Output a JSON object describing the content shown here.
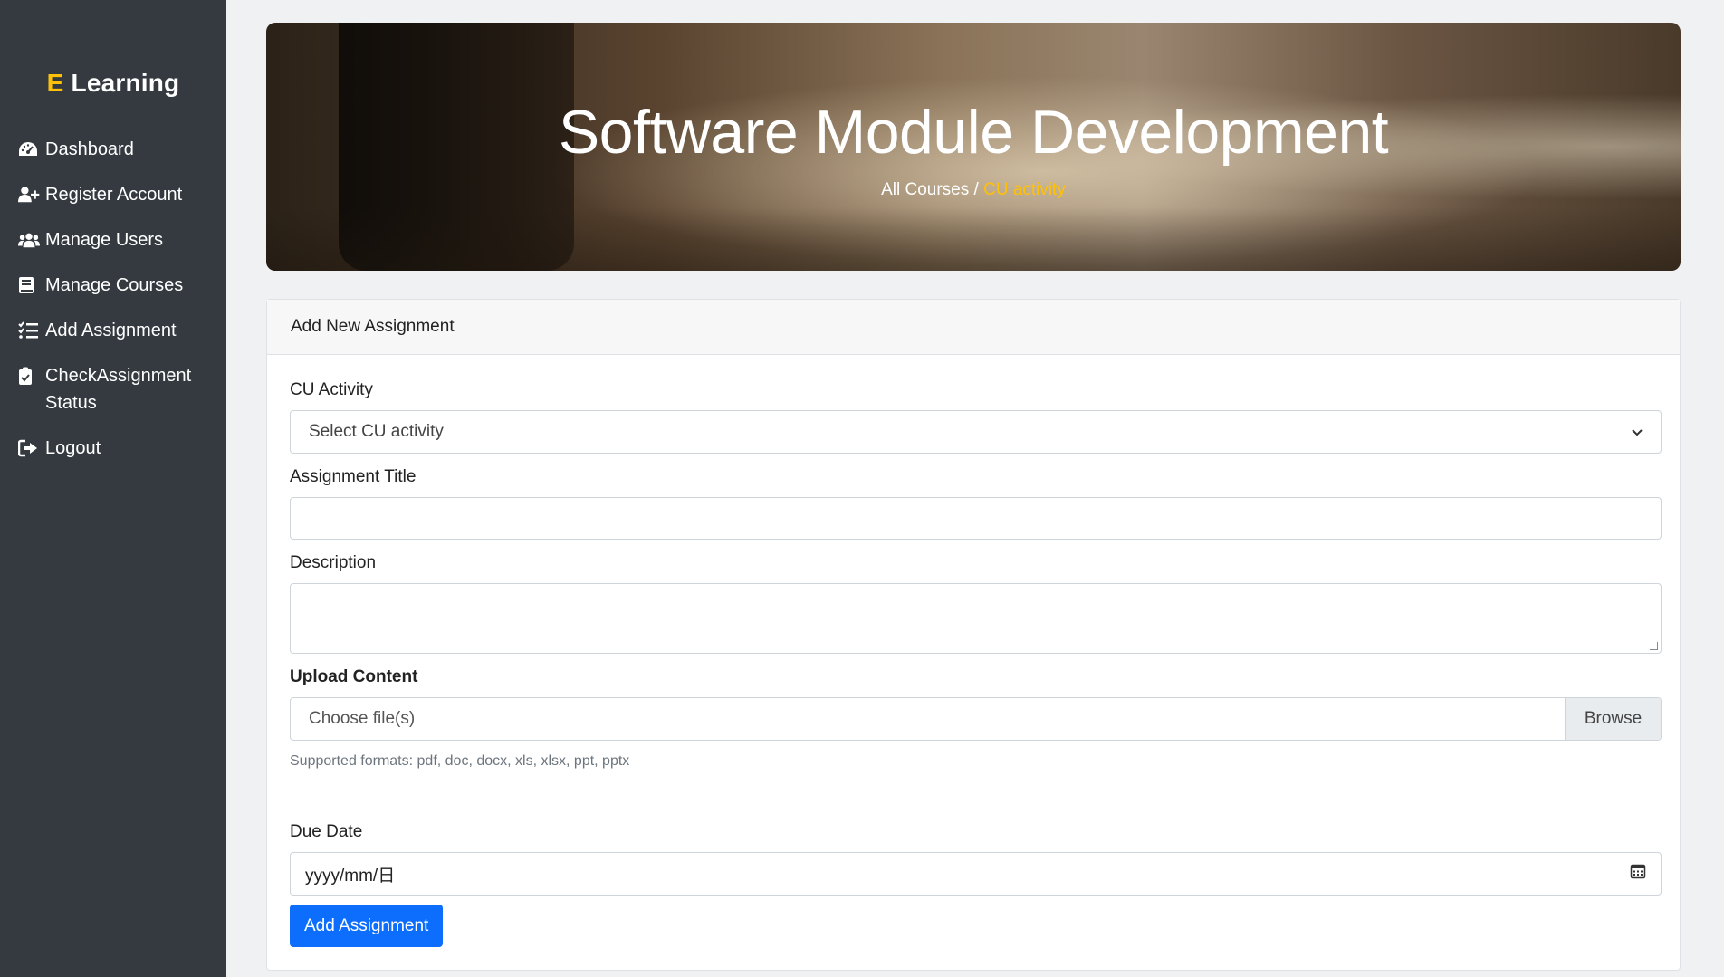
{
  "brand": {
    "prefix": "E",
    "name": "Learning"
  },
  "sidebar": {
    "items": [
      {
        "label": "Dashboard",
        "icon": "dashboard-gauge-icon"
      },
      {
        "label": "Register Account",
        "icon": "user-plus-icon"
      },
      {
        "label": "Manage Users",
        "icon": "users-icon"
      },
      {
        "label": "Manage Courses",
        "icon": "book-icon"
      },
      {
        "label": "Add Assignment",
        "icon": "list-check-icon"
      },
      {
        "label": "CheckAssignment Status",
        "icon": "clipboard-check-icon"
      },
      {
        "label": "Logout",
        "icon": "sign-out-icon"
      }
    ]
  },
  "hero": {
    "title": "Software Module Development",
    "breadcrumb": {
      "root": "All Courses",
      "separator": " / ",
      "current": "CU activity"
    }
  },
  "form": {
    "header": "Add New Assignment",
    "cu_activity": {
      "label": "CU Activity",
      "selected": "Select CU activity"
    },
    "title": {
      "label": "Assignment Title",
      "value": ""
    },
    "description": {
      "label": "Description",
      "value": ""
    },
    "upload": {
      "label": "Upload Content",
      "placeholder": "Choose file(s)",
      "browse": "Browse",
      "help": "Supported formats: pdf, doc, docx, xls, xlsx, ppt, pptx"
    },
    "due_date": {
      "label": "Due Date",
      "placeholder": "yyyy/mm/日"
    },
    "submit": "Add Assignment"
  },
  "colors": {
    "sidebar_bg": "#343a40",
    "accent": "#ffc107",
    "primary": "#0d6efd"
  }
}
